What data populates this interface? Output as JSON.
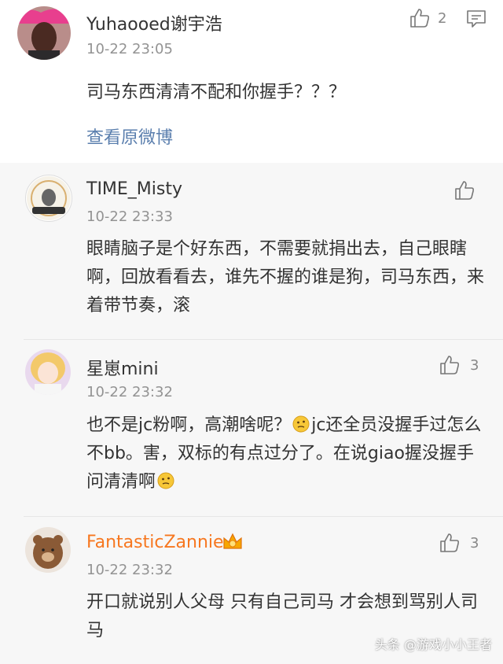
{
  "post": {
    "username": "Yuhaooed谢宇浩",
    "timestamp": "10-22 23:05",
    "like_count": "2",
    "content": "司马东西清清不配和你握手？？？",
    "view_original": "查看原微博"
  },
  "replies": [
    {
      "username": "TIME_Misty",
      "timestamp": "10-22 23:33",
      "like_count": "",
      "content": "眼睛脑子是个好东西，不需要就捐出去，自己眼瞎啊，回放看看去，谁先不握的谁是狗，司马东西，来着带节奏，滚"
    },
    {
      "username": "星崽mini",
      "timestamp": "10-22 23:32",
      "like_count": "3",
      "content_1": "也不是jc粉啊，高潮啥呢？",
      "content_2": "jc还全员没握手过怎么不bb。害，双标的有点过分了。在说giao握没握手问清清啊"
    },
    {
      "username": "FantasticZannie",
      "timestamp": "10-22 23:32",
      "like_count": "3",
      "content": "开口就说别人父母 只有自己司马 才会想到骂别人司马"
    }
  ],
  "watermark": "头条 @游戏小小王者",
  "colors": {
    "link": "#5b7fae",
    "vip_name": "#f7771f",
    "reply_background": "#f7f7f7",
    "timestamp": "#939393"
  },
  "icons": [
    "like-icon",
    "comment-icon",
    "thinking-emoji",
    "crown-badge-icon"
  ]
}
